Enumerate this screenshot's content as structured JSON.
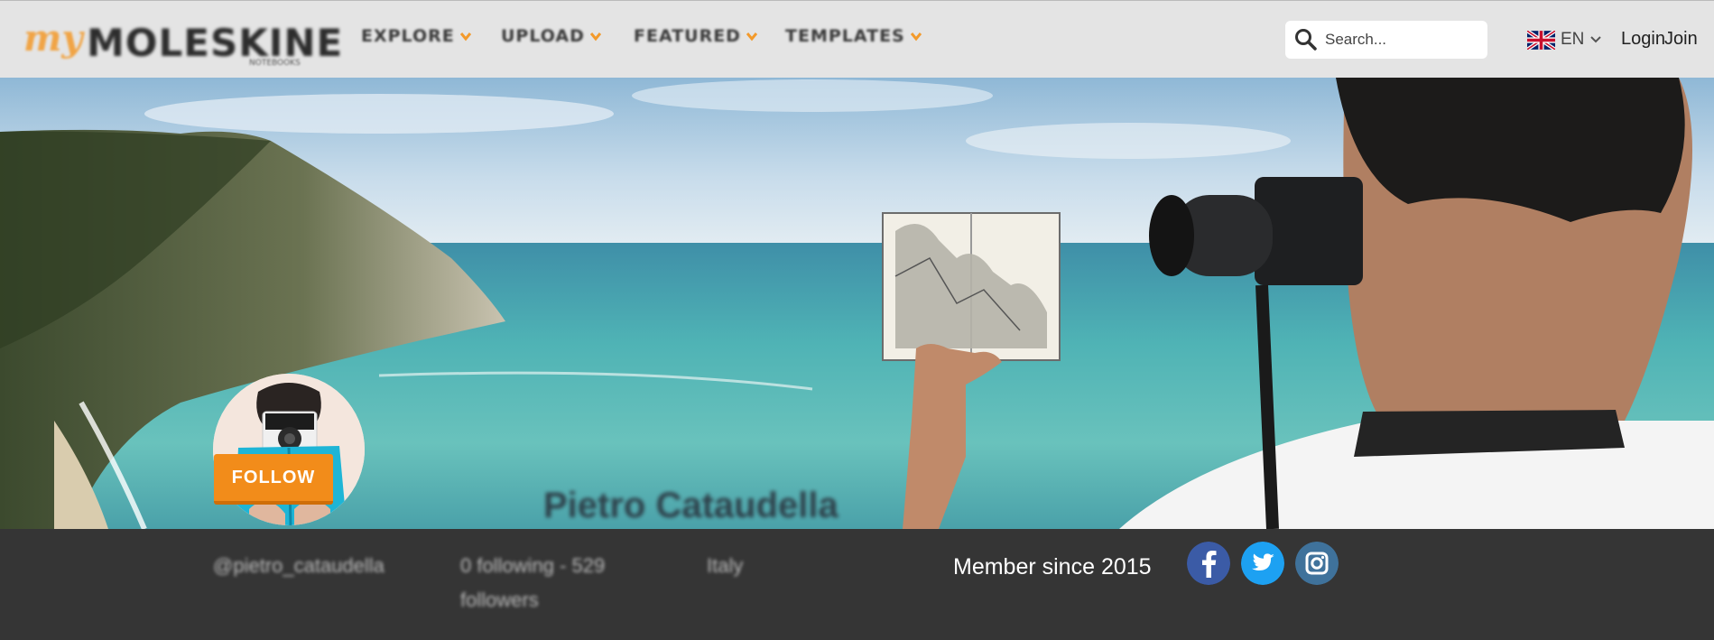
{
  "header": {
    "logo": {
      "my": "my",
      "word": "MOLESKINE",
      "sub": "NOTEBOOKS"
    },
    "nav": [
      {
        "label": "EXPLORE"
      },
      {
        "label": "UPLOAD"
      },
      {
        "label": "FEATURED"
      },
      {
        "label": "TEMPLATES"
      }
    ],
    "search": {
      "placeholder": "Search..."
    },
    "language": {
      "code": "EN"
    },
    "login_label": "Login",
    "join_label": "Join"
  },
  "profile": {
    "name": "Pietro Cataudella",
    "follow_label": "FOLLOW",
    "handle": "@pietro_cataudella",
    "follow_stats_line1": "0 following - 529",
    "follow_stats_line2": "followers",
    "location": "Italy",
    "member_since": "Member since 2015"
  },
  "colors": {
    "accent": "#f28c1a",
    "header_bg": "#e4e4e4",
    "footer_bg": "#353535",
    "facebook": "#3b5ba6",
    "twitter": "#1da1f2",
    "instagram": "#3f729b"
  },
  "icons": [
    "search-icon",
    "uk-flag-icon",
    "chevron-down-icon",
    "facebook-icon",
    "twitter-icon",
    "instagram-icon"
  ]
}
